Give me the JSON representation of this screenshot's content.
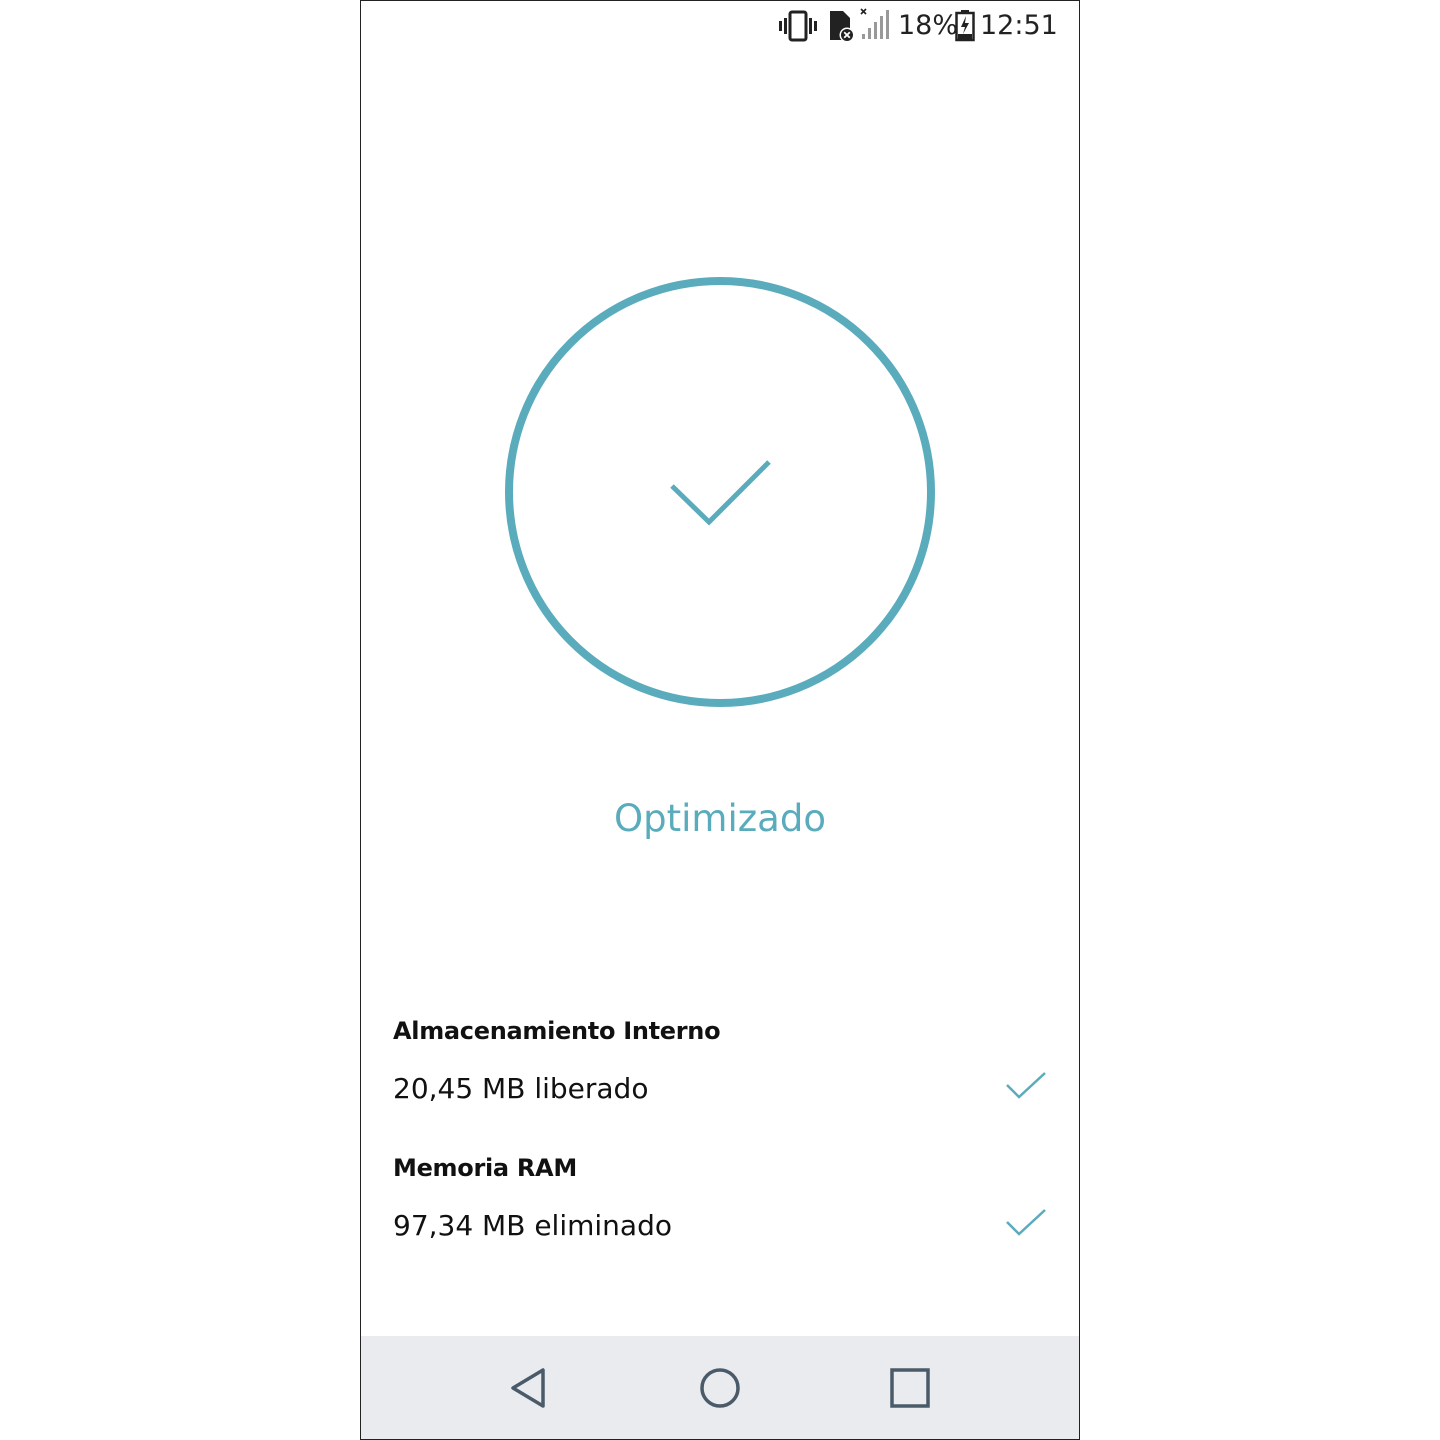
{
  "status_bar": {
    "battery_percent_label": "18%",
    "time": "12:51",
    "icons": [
      "vibrate-icon",
      "no-sim-icon",
      "signal-off-icon",
      "battery-charging-icon"
    ]
  },
  "hero": {
    "icon": "check-circle-icon",
    "title": "Optimizado"
  },
  "results": [
    {
      "title": "Almacenamiento Interno",
      "value": "20,45 MB liberado",
      "icon": "check-icon"
    },
    {
      "title": "Memoria RAM",
      "value": "97,34 MB eliminado",
      "icon": "check-icon"
    }
  ],
  "nav_bar": {
    "buttons": [
      "back-icon",
      "home-icon",
      "recents-icon"
    ]
  },
  "colors": {
    "accent": "#5aacbd",
    "text": "#111111",
    "nav_background": "#e9ebee"
  }
}
